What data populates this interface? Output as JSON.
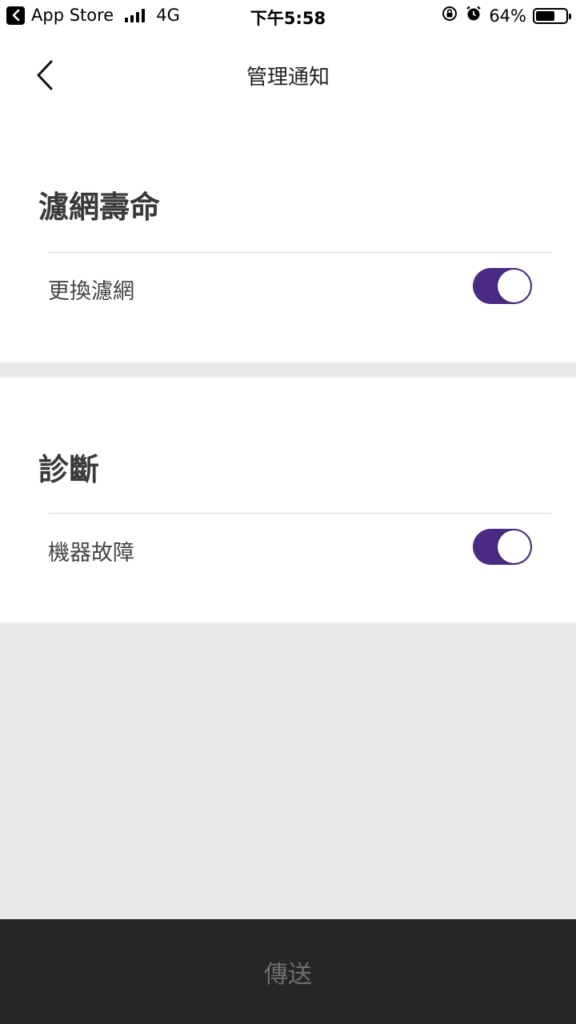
{
  "status_bar": {
    "back_app": "App Store",
    "network": "4G",
    "time": "下午5:58",
    "battery": "64%",
    "battery_level": 0.64,
    "icons": [
      "chevron-left-icon",
      "signal-icon",
      "rotation-lock-icon",
      "alarm-icon",
      "battery-icon"
    ]
  },
  "nav": {
    "title": "管理通知",
    "back_icon": "chevron-left-icon"
  },
  "sections": [
    {
      "title": "濾網壽命",
      "rows": [
        {
          "label": "更換濾網",
          "enabled": true
        }
      ]
    },
    {
      "title": "診斷",
      "rows": [
        {
          "label": "機器故障",
          "enabled": true
        }
      ]
    }
  ],
  "footer": {
    "send_label": "傳送"
  },
  "colors": {
    "toggle_on": "#4a2a82",
    "footer_bg": "#262626",
    "page_bg": "#e9e9e9"
  }
}
